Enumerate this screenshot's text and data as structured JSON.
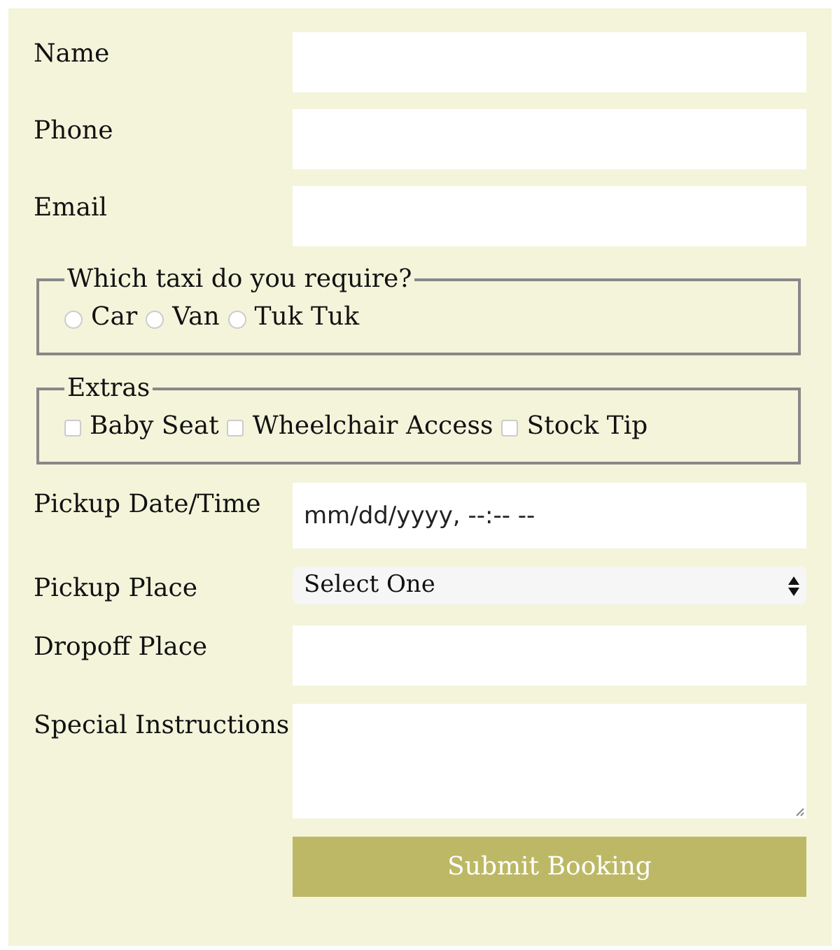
{
  "fields_top": [
    {
      "label": "Name",
      "kind": "text"
    },
    {
      "label": "Phone",
      "kind": "text"
    },
    {
      "label": "Email",
      "kind": "text"
    }
  ],
  "taxi": {
    "legend": "Which taxi do you require?",
    "options": [
      {
        "label": "Car",
        "selected": false
      },
      {
        "label": "Van",
        "selected": false
      },
      {
        "label": "Tuk Tuk",
        "selected": false
      }
    ]
  },
  "extras": {
    "legend": "Extras",
    "options": [
      {
        "label": "Baby Seat",
        "checked": false
      },
      {
        "label": "Wheelchair Access",
        "checked": false
      },
      {
        "label": "Stock Tip",
        "checked": false
      }
    ]
  },
  "fields_bottom": [
    {
      "label": "Pickup Date/Time",
      "kind": "datetime",
      "placeholder": "mm/dd/yyyy, --:-- --"
    },
    {
      "label": "Pickup Place",
      "kind": "select",
      "value": "Select One"
    },
    {
      "label": "Dropoff Place",
      "kind": "text"
    },
    {
      "label": "Special Instructions",
      "kind": "textarea"
    }
  ],
  "submit": "Submit Booking"
}
